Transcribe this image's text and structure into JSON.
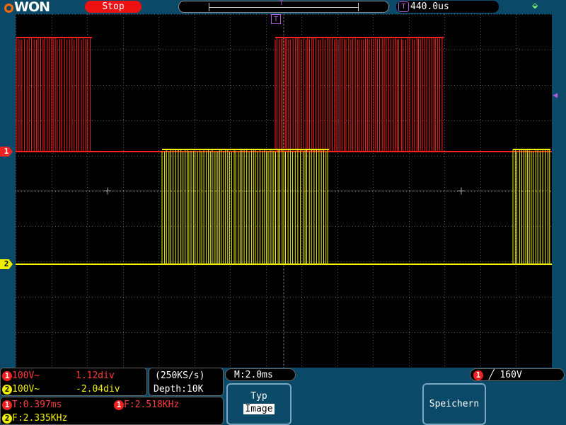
{
  "header": {
    "logo": "WON",
    "run_state": "Stop",
    "timeline_marker": "T",
    "trigger_badge": "T",
    "trigger_delay": "440.0us"
  },
  "channels": {
    "ch1": {
      "number": "1",
      "color": "#ff2020",
      "volts": "100V~",
      "position": "1.12div"
    },
    "ch2": {
      "number": "2",
      "color": "#f0f000",
      "volts": "100V~",
      "position": "-2.04div"
    }
  },
  "acquisition": {
    "sample_rate": "(250KS/s)",
    "depth": "Depth:10K"
  },
  "timebase": "M:2.0ms",
  "trigger": {
    "channel": "1",
    "edge_symbol": "╱",
    "level": "160V"
  },
  "measurements": {
    "ch1_period": "T:0.397ms",
    "ch1_freq": "F:2.518KHz",
    "ch2_freq": "F:2.335KHz"
  },
  "buttons": {
    "type_label": "Typ",
    "type_value": "Image",
    "save_label": "Speichern"
  },
  "markers": {
    "trigger_position": "T"
  }
}
